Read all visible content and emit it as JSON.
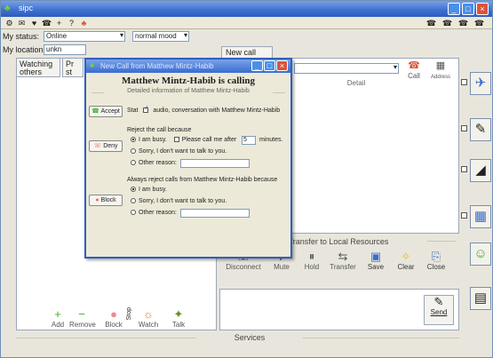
{
  "window": {
    "title": "sipc",
    "minimize": "_",
    "maximize": "□",
    "close": "×"
  },
  "toolbar": {
    "icons": [
      "⚙",
      "✉",
      "♥",
      "☎",
      "+",
      "?",
      "♣"
    ],
    "right_icons": [
      "☎",
      "☎",
      "☎",
      "☎"
    ]
  },
  "status": {
    "status_label": "My status:",
    "status_value": "Online",
    "mood_value": "normal mood",
    "location_label": "My location:",
    "location_value": "unkn"
  },
  "left": {
    "tab_watching": "Watching others",
    "tab_partial": "Pr st"
  },
  "left_buttons": [
    {
      "label": "Add",
      "icon": "+"
    },
    {
      "label": "Remove",
      "icon": "−"
    },
    {
      "label": "Block",
      "icon": "●"
    },
    {
      "label": "Watch",
      "icon": "☼"
    },
    {
      "label": "Talk",
      "icon": "✦"
    }
  ],
  "stop_label": "Stop",
  "new_call": {
    "tab_label": "New call",
    "call_label": "Call",
    "address_label": "Address",
    "detail_label": "Detail"
  },
  "transfer": {
    "title": "Transfer to Local Resources"
  },
  "transfer_buttons": [
    {
      "label": "Disconnect",
      "icon": "☏"
    },
    {
      "label": "Mute",
      "icon": "♪"
    },
    {
      "label": "Hold",
      "icon": "⏸"
    },
    {
      "label": "Transfer",
      "icon": "⇆"
    },
    {
      "label": "Save",
      "icon": "▣"
    },
    {
      "label": "Clear",
      "icon": "✧"
    },
    {
      "label": "Close",
      "icon": "⎘"
    }
  ],
  "send": {
    "label": "Send",
    "icon": "✎"
  },
  "services": {
    "label": "Services"
  },
  "side_icons": [
    "✈",
    "✎",
    "◢",
    "▦",
    "☺",
    "▤"
  ],
  "dialog": {
    "title": "New Call from Matthew Mintz-Habib",
    "heading": "Matthew Mintz-Habib is calling",
    "subheading": "Detailed information of Matthew Mintz-Habib",
    "accept_label": "Accept",
    "deny_label": "Deny",
    "block_label": "Block",
    "stat_label": "Stat",
    "stat_info": "audio, conversation with Matthew Mintz-Habib",
    "reject_title": "Reject the call because",
    "reject_busy": "I am busy.",
    "reject_call_after": "Please call me after",
    "reject_minutes_value": "5",
    "reject_minutes": "minutes.",
    "reject_sorry": "Sorry, I don't want to talk to you.",
    "reject_other": "Other reason:",
    "always_title": "Always reject calls from Matthew Mintz-Habib because",
    "always_busy": "I am busy.",
    "always_sorry": "Sorry, I don't want to talk to you.",
    "always_other": "Other reason:"
  },
  "colors": {
    "titlebar": "#3c6fd0",
    "accent": "#7ed321",
    "panel": "#ece9d8"
  }
}
